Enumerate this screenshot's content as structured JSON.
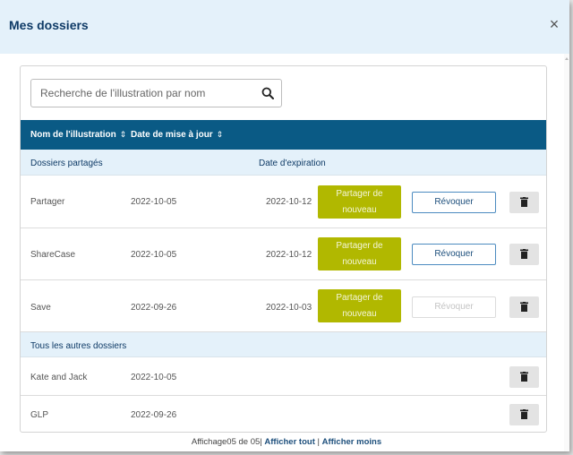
{
  "modal": {
    "title": "Mes dossiers",
    "close_label": "×"
  },
  "search": {
    "placeholder": "Recherche de l'illustration par nom",
    "icon": "search-icon"
  },
  "table": {
    "headers": {
      "name": "Nom de l'illustration",
      "date": "Date de mise à jour"
    },
    "shared_section": {
      "title": "Dossiers partagés",
      "expiry_header": "Date d'expiration"
    },
    "shared_rows": [
      {
        "name": "Partager",
        "date": "2022-10-05",
        "expiry": "2022-10-12",
        "share_label_1": "Partager de",
        "share_label_2": "nouveau",
        "revoke_label": "Révoquer",
        "revoke_enabled": true
      },
      {
        "name": "ShareCase",
        "date": "2022-10-05",
        "expiry": "2022-10-12",
        "share_label_1": "Partager de",
        "share_label_2": "nouveau",
        "revoke_label": "Révoquer",
        "revoke_enabled": true
      },
      {
        "name": "Save",
        "date": "2022-09-26",
        "expiry": "2022-10-03",
        "share_label_1": "Partager de",
        "share_label_2": "nouveau",
        "revoke_label": "Révoquer",
        "revoke_enabled": false
      }
    ],
    "other_section": {
      "title": "Tous les autres dossiers"
    },
    "other_rows": [
      {
        "name": "Kate and Jack",
        "date": "2022-10-05"
      },
      {
        "name": "GLP",
        "date": "2022-09-26"
      }
    ]
  },
  "footer": {
    "count_text": "Affichage05 de 05|",
    "show_all": "Afficher tout",
    "separator": "|",
    "show_less": "Afficher moins"
  },
  "colors": {
    "header_bg": "#e4f1fa",
    "table_header": "#0a5a85",
    "share_button": "#b1b800",
    "revoke_border": "#4c8bc0"
  }
}
